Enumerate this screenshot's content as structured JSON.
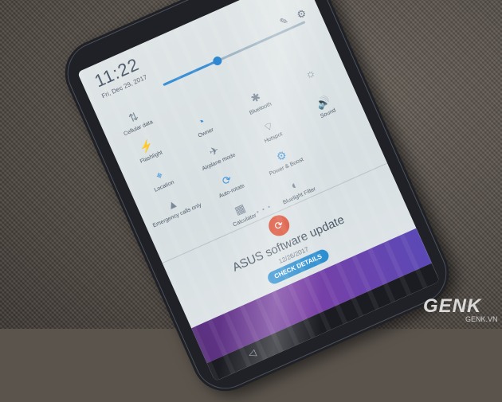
{
  "status": {
    "time": "11:22",
    "date": "Fri, Dec 29, 2017"
  },
  "header_icons": {
    "settings": "gear-icon",
    "edit": "edit-icon"
  },
  "brightness": {
    "level": 0.38,
    "accent": "#3a8fd6"
  },
  "quick_settings": [
    [
      {
        "label": "Cellular data",
        "icon": "⇅",
        "on": false
      },
      {
        "label": "",
        "icon": "",
        "on": false
      },
      {
        "label": "",
        "icon": "",
        "on": false
      },
      {
        "label": "",
        "icon": "",
        "on": false
      }
    ],
    [
      {
        "label": "Flashlight",
        "icon": "⚡",
        "on": false
      },
      {
        "label": "Owner",
        "icon": "◔",
        "on": true
      },
      {
        "label": "Bluetooth",
        "icon": "✱",
        "on": false
      },
      {
        "label": "",
        "icon": "☼",
        "on": false
      }
    ],
    [
      {
        "label": "Location",
        "icon": "⌖",
        "on": true
      },
      {
        "label": "Airplane mode",
        "icon": "✈",
        "on": false
      },
      {
        "label": "Hotspot",
        "icon": "⌔",
        "on": false
      },
      {
        "label": "Sound",
        "icon": "🔊",
        "on": true
      }
    ],
    [
      {
        "label": "Emergency calls only",
        "icon": "▲",
        "on": false
      },
      {
        "label": "Auto-rotate",
        "icon": "⟳",
        "on": true
      },
      {
        "label": "Power & Boost",
        "icon": "⚙",
        "on": true
      },
      {
        "label": "",
        "icon": "",
        "on": false
      }
    ],
    [
      {
        "label": "",
        "icon": "",
        "on": false
      },
      {
        "label": "Calculator",
        "icon": "▦",
        "on": false
      },
      {
        "label": "Bluelight Filter",
        "icon": "◐",
        "on": false
      },
      {
        "label": "",
        "icon": "",
        "on": false
      }
    ]
  ],
  "notification": {
    "icon": "update-icon",
    "title": "ASUS software update",
    "date": "12/26/2017",
    "button": "CHECK DETAILS"
  },
  "watermark": {
    "logo": "GENK",
    "site": "GENK.VN"
  }
}
